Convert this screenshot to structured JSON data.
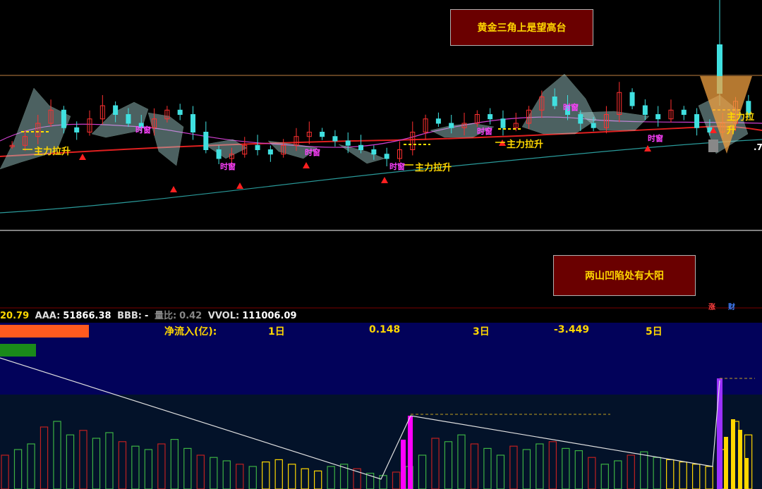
{
  "annotations": {
    "top_note": "黄金三角上是望高台",
    "bottom_note": "两山凹陷处有大阳",
    "lift_label": "主力拉升",
    "buy_label": "时窗"
  },
  "stats": {
    "price": "20.79",
    "aaa_label": "AAA:",
    "aaa_value": "51866.38",
    "bbb_label": "BBB:",
    "bbb_value": "-",
    "ratio_label": "量比:",
    "ratio_value": "0.42",
    "vvol_label": "VVOL:",
    "vvol_value": "111006.09"
  },
  "flow": {
    "label": "净流入(亿):",
    "p1_label": "1日",
    "p1_value": "0.148",
    "p3_label": "3日",
    "p3_value": "-3.449",
    "p5_label": "5日"
  },
  "side_tags": {
    "rise": "涨",
    "fin": "财",
    "right_edge": ".7"
  },
  "colors": {
    "up": "#ff3030",
    "down": "#40e0e0",
    "ma_red": "#e02020",
    "ma_magenta": "#d040d0",
    "ma_teal": "#2a9a9a",
    "bar_green": "#3cb043",
    "bar_red": "#c02020",
    "bar_yellow": "#ffd700",
    "bar_magenta": "#ff00ff",
    "bar_purple": "#9b30ff",
    "panel_blue": "#02025a"
  },
  "chart_data": {
    "type": "candlestick",
    "price_series": [
      20.1,
      20.3,
      20.6,
      20.9,
      20.5,
      20.4,
      20.7,
      21.0,
      20.8,
      20.6,
      20.5,
      20.7,
      20.9,
      20.8,
      20.4,
      20.0,
      19.8,
      19.9,
      20.1,
      20.0,
      19.9,
      20.1,
      20.3,
      20.4,
      20.3,
      20.2,
      20.1,
      20.0,
      19.9,
      19.8,
      20.0,
      20.4,
      20.7,
      20.6,
      20.5,
      20.6,
      20.8,
      20.7,
      20.5,
      20.6,
      20.9,
      21.2,
      21.0,
      20.8,
      20.6,
      20.5,
      20.8,
      21.3,
      21.0,
      20.8,
      20.7,
      20.9,
      20.8,
      20.5,
      20.4,
      20.6,
      21.1,
      20.8
    ],
    "volume_series": [
      30,
      35,
      40,
      55,
      60,
      48,
      52,
      45,
      50,
      42,
      38,
      35,
      40,
      44,
      36,
      30,
      28,
      25,
      22,
      20,
      24,
      26,
      22,
      18,
      16,
      20,
      22,
      18,
      14,
      12,
      15,
      20,
      30,
      45,
      42,
      48,
      40,
      36,
      30,
      38,
      35,
      40,
      42,
      36,
      34,
      28,
      22,
      25,
      30,
      33,
      28,
      26,
      24,
      22,
      20,
      35,
      60,
      48
    ]
  }
}
